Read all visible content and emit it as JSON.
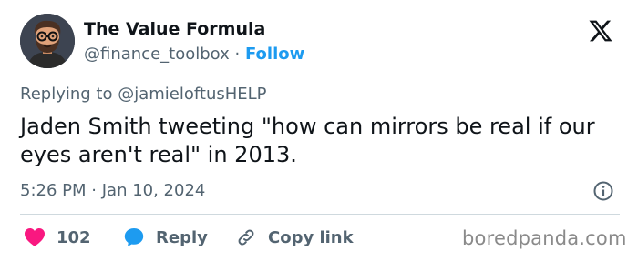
{
  "author": {
    "display_name": "The Value Formula",
    "handle": "@finance_toolbox",
    "separator": "·",
    "follow_label": "Follow",
    "avatar": "bearded-man-with-glasses-avatar"
  },
  "platform_logo": "x-logo-icon",
  "reply_context": {
    "prefix": "Replying to",
    "mention": "@jamieloftusHELP"
  },
  "tweet": {
    "text": "Jaden Smith tweeting \"how can mirrors be real if our eyes aren't real\" in 2013.",
    "time": "5:26 PM",
    "date_separator": "·",
    "date": "Jan 10, 2024"
  },
  "actions": {
    "likes_count": "102",
    "reply_label": "Reply",
    "copy_label": "Copy link"
  },
  "icons": {
    "like": "heart-icon",
    "reply": "speech-bubble-icon",
    "copy": "link-icon",
    "info": "info-icon"
  },
  "colors": {
    "text_primary": "#0f1419",
    "text_secondary": "#536471",
    "link_blue": "#1d9bf0",
    "like_pink": "#f91880",
    "divider": "#cfd9de"
  },
  "watermark": "boredpanda.com"
}
